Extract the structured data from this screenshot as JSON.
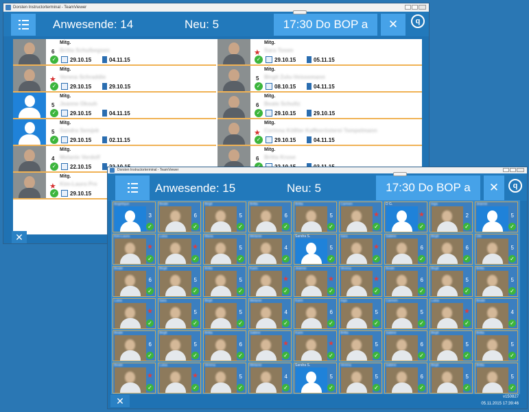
{
  "back_window": {
    "title": "Dorsten Instructorterminal - TeamViewer",
    "header": {
      "present_label": "Anwesende: 14",
      "new_label": "Neu: 5",
      "session": "17:30 Do BOP a"
    },
    "rows": [
      {
        "type": "Mitg.",
        "num": "6",
        "star": false,
        "name": "Britta Schulbegsen",
        "d1": "29.10.15",
        "d2": "04.11.15",
        "photo": "person"
      },
      {
        "type": "Mitg.",
        "num": "",
        "star": true,
        "name": "Sara Tosen",
        "d1": "29.10.15",
        "d2": "05.11.15",
        "photo": "person"
      },
      {
        "type": "Mitg.",
        "num": "",
        "star": true,
        "name": "Verena Schraddie",
        "d1": "29.10.15",
        "d2": "29.10.15",
        "photo": "person"
      },
      {
        "type": "Mitg.",
        "num": "5",
        "star": false,
        "name": "Birgit Zulu-Veissemann",
        "d1": "08.10.15",
        "d2": "04.11.15",
        "photo": "person"
      },
      {
        "type": "Mitg.",
        "num": "5",
        "star": false,
        "name": "Jeanne Oksuh",
        "d1": "29.10.15",
        "d2": "04.11.15",
        "photo": "silhouette"
      },
      {
        "type": "Mitg.",
        "num": "6",
        "star": false,
        "name": "Beate Schultz",
        "d1": "29.10.15",
        "d2": "29.10.15",
        "photo": "person"
      },
      {
        "type": "Mitg.",
        "num": "5",
        "star": false,
        "name": "Sandra Semjek",
        "d1": "29.10.15",
        "d2": "02.11.15",
        "photo": "silhouette"
      },
      {
        "type": "Mitg.",
        "num": "",
        "star": true,
        "name": "Corinna Kößler Kaffeerösterei Tempelmann",
        "d1": "29.10.15",
        "d2": "04.11.15",
        "photo": "person"
      },
      {
        "type": "Mitg.",
        "num": "4",
        "star": false,
        "name": "Melanie Verdolf",
        "d1": "22.10.15",
        "d2": "22.10.15",
        "photo": "person"
      },
      {
        "type": "Mitg.",
        "num": "6",
        "star": false,
        "name": "Britta Kruse",
        "d1": "22.10.15",
        "d2": "03.11.15",
        "photo": "person"
      },
      {
        "type": "Mitg.",
        "num": "",
        "star": true,
        "name": "Kim-Laura Pre",
        "d1": "29.10.15",
        "d2": "",
        "photo": "person"
      },
      {
        "type": "Mitg.",
        "num": "5",
        "star": false,
        "name": "Maria Haack",
        "d1": "29.10.15",
        "d2": "",
        "photo": "person"
      }
    ]
  },
  "front_window": {
    "title": "Dorsten Instructorterminal - TeamViewer",
    "header": {
      "present_label": "Anwesende: 15",
      "new_label": "Neu: 5",
      "session": "17:30 Do BOP a"
    },
    "version": "v150827",
    "timestamp": "05.11.2015 17:39:46",
    "tiles": [
      {
        "n": "Angelique",
        "v": "3",
        "s": false,
        "p": "sil"
      },
      {
        "n": "Beate",
        "v": "6",
        "s": false,
        "p": "f"
      },
      {
        "n": "Birgit",
        "v": "5",
        "s": false,
        "p": "f"
      },
      {
        "n": "Britta",
        "v": "6",
        "s": false,
        "p": "f"
      },
      {
        "n": "Britta",
        "v": "5",
        "s": false,
        "p": "f"
      },
      {
        "n": "Carmen",
        "v": "",
        "s": true,
        "p": "f"
      },
      {
        "n": "D G.",
        "v": "",
        "s": true,
        "p": "sil"
      },
      {
        "n": "Inga",
        "v": "2",
        "s": false,
        "p": "f"
      },
      {
        "n": "Jeanne",
        "v": "5",
        "s": false,
        "p": "sil"
      },
      {
        "n": "Kim-Laura",
        "v": "",
        "s": true,
        "p": "f"
      },
      {
        "n": "Luisa",
        "v": "",
        "s": true,
        "p": "f"
      },
      {
        "n": "Maria",
        "v": "5",
        "s": false,
        "p": "f"
      },
      {
        "n": "Melanie",
        "v": "4",
        "s": false,
        "p": "f"
      },
      {
        "n": "Sandra S.",
        "v": "5",
        "s": false,
        "p": "sil"
      },
      {
        "n": "Sara",
        "v": "",
        "s": true,
        "p": "f"
      },
      {
        "n": "Sabine",
        "v": "6",
        "s": false,
        "p": "f"
      },
      {
        "n": "Birgit",
        "v": "6",
        "s": false,
        "p": "f"
      },
      {
        "n": "Ute",
        "v": "5",
        "s": false,
        "p": "f"
      },
      {
        "n": "Beate",
        "v": "6",
        "s": false,
        "p": "f"
      },
      {
        "n": "Birgit",
        "v": "5",
        "s": false,
        "p": "f"
      },
      {
        "n": "Britta",
        "v": "5",
        "s": false,
        "p": "f"
      },
      {
        "n": "Karin",
        "v": "",
        "s": true,
        "p": "f"
      },
      {
        "n": "Jeanne",
        "v": "",
        "s": true,
        "p": "f"
      },
      {
        "n": "Verena",
        "v": "",
        "s": true,
        "p": "f"
      },
      {
        "n": "Beate",
        "v": "6",
        "s": false,
        "p": "f"
      },
      {
        "n": "Birgit",
        "v": "5",
        "s": false,
        "p": "f"
      },
      {
        "n": "Britta",
        "v": "5",
        "s": false,
        "p": "f"
      },
      {
        "n": "Luisa",
        "v": "",
        "s": true,
        "p": "f"
      },
      {
        "n": "Sara",
        "v": "5",
        "s": false,
        "p": "f"
      },
      {
        "n": "Birgit",
        "v": "5",
        "s": false,
        "p": "f"
      },
      {
        "n": "Melanie",
        "v": "4",
        "s": false,
        "p": "f"
      },
      {
        "n": "Karin",
        "v": "6",
        "s": false,
        "p": "f"
      },
      {
        "n": "Inga",
        "v": "5",
        "s": false,
        "p": "f"
      },
      {
        "n": "Carmen",
        "v": "5",
        "s": false,
        "p": "f"
      },
      {
        "n": "Luisa",
        "v": "",
        "s": true,
        "p": "f"
      },
      {
        "n": "Beate",
        "v": "4",
        "s": false,
        "p": "f"
      },
      {
        "n": "Beate",
        "v": "6",
        "s": false,
        "p": "f"
      },
      {
        "n": "Birgit",
        "v": "5",
        "s": false,
        "p": "f"
      },
      {
        "n": "Britta",
        "v": "6",
        "s": false,
        "p": "f"
      },
      {
        "n": "Sabine",
        "v": "",
        "s": true,
        "p": "f"
      },
      {
        "n": "Karin",
        "v": "",
        "s": true,
        "p": "f"
      },
      {
        "n": "Britta",
        "v": "5",
        "s": false,
        "p": "f"
      },
      {
        "n": "Sabine",
        "v": "6",
        "s": false,
        "p": "f"
      },
      {
        "n": "Birgit",
        "v": "5",
        "s": false,
        "p": "f"
      },
      {
        "n": "Britta",
        "v": "5",
        "s": false,
        "p": "f"
      },
      {
        "n": "Beate",
        "v": "",
        "s": true,
        "p": "f"
      },
      {
        "n": "Luisa",
        "v": "",
        "s": true,
        "p": "f"
      },
      {
        "n": "Verena",
        "v": "5",
        "s": false,
        "p": "f"
      },
      {
        "n": "Melanie",
        "v": "4",
        "s": false,
        "p": "f"
      },
      {
        "n": "Sandra S.",
        "v": "5",
        "s": false,
        "p": "sil"
      },
      {
        "n": "Verena",
        "v": "5",
        "s": false,
        "p": "f"
      },
      {
        "n": "Sabine",
        "v": "6",
        "s": false,
        "p": "f"
      },
      {
        "n": "Birgit",
        "v": "5",
        "s": false,
        "p": "f"
      },
      {
        "n": "Britta",
        "v": "5",
        "s": false,
        "p": "f"
      }
    ]
  }
}
